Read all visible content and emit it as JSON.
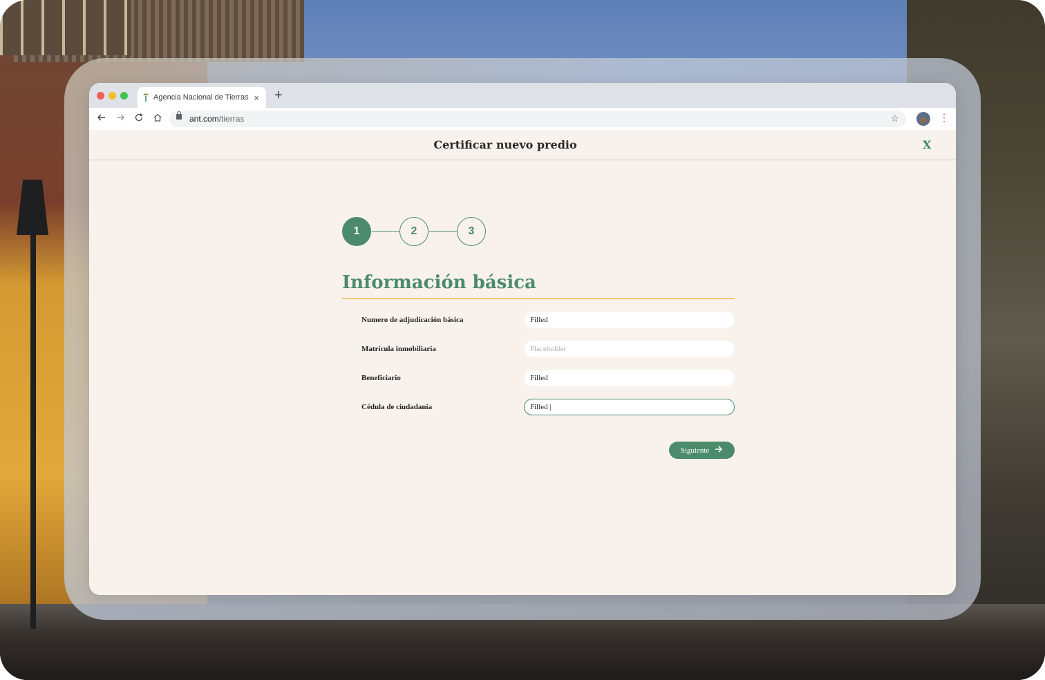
{
  "browser": {
    "tab_title": "Agencia Nacional de Tierras",
    "tab_close": "×",
    "new_tab": "+",
    "url_host": "ant.com",
    "url_path": "/tierras"
  },
  "header": {
    "title": "Certificar nuevo predio",
    "close_label": "X"
  },
  "stepper": {
    "steps": [
      "1",
      "2",
      "3"
    ],
    "active": 1
  },
  "section": {
    "title": "Información básica"
  },
  "form": {
    "fields": [
      {
        "label": "Numero de adjudicación básica",
        "value": "Filled",
        "placeholder": ""
      },
      {
        "label": "Matrícula inmobiliaria",
        "value": "",
        "placeholder": "Placeholder"
      },
      {
        "label": "Beneficiario",
        "value": "Filled",
        "placeholder": ""
      },
      {
        "label": "Cédula de ciudadania",
        "value": "Filled |",
        "placeholder": ""
      }
    ],
    "next_label": "Siguiente"
  },
  "colors": {
    "primary": "#4b8b6b",
    "accent_rule": "#efc96c",
    "page_bg": "#f9f2ec"
  }
}
